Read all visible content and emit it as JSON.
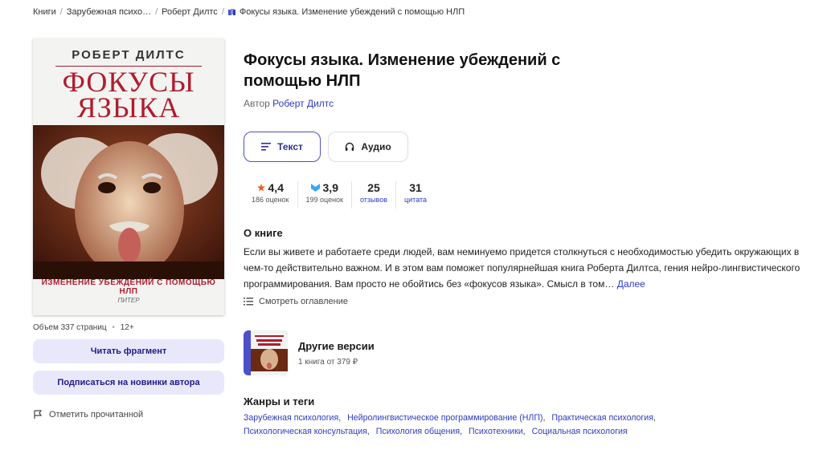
{
  "breadcrumb": {
    "items": [
      "Книги",
      "Зарубежная психо…",
      "Роберт Дилтс"
    ],
    "current": "Фокусы языка. Изменение убеждений с помощью НЛП"
  },
  "cover": {
    "author": "РОБЕРТ ДИЛТС",
    "title_line1": "ФОКУСЫ",
    "title_line2": "ЯЗЫКА",
    "subtitle": "ИЗМЕНЕНИЕ УБЕЖДЕНИЙ С ПОМОЩЬЮ НЛП",
    "publisher": "ПИТЕР"
  },
  "meta": {
    "pages": "Объем 337 страниц",
    "age": "12+"
  },
  "actions": {
    "read_fragment": "Читать фрагмент",
    "subscribe": "Подписаться на новинки автора",
    "mark_read": "Отметить прочитанной"
  },
  "book": {
    "title": "Фокусы языка. Изменение убеждений с помощью НЛП",
    "author_prefix": "Автор",
    "author": "Роберт Дилтс"
  },
  "formats": {
    "text": "Текст",
    "audio": "Аудио"
  },
  "stats": [
    {
      "value": "4,4",
      "label": "186 оценок",
      "icon": "star-icon"
    },
    {
      "value": "3,9",
      "label": "199 оценок",
      "icon": "bookmate-icon"
    },
    {
      "value": "25",
      "label": "отзывов"
    },
    {
      "value": "31",
      "label": "цитата"
    }
  ],
  "about": {
    "heading": "О книге",
    "text": "Если вы живете и работаете среди людей, вам неминуемо придется столкнуться с необходимостью убедить окружающих в чем-то действительно важном. И в этом вам поможет популярнейшая книга Роберта Дилтса, гения нейро-лингвистического программирования. Вам просто не обойтись без «фокусов языка». Смысл в том…",
    "more": "Далее",
    "toc": "Смотреть оглавление"
  },
  "versions": {
    "title": "Другие версии",
    "subtitle": "1 книга от 379 ₽"
  },
  "genres": {
    "heading": "Жанры и теги",
    "tags": [
      "Зарубежная психология",
      "Нейролингвистическое программирование (НЛП)",
      "Практическая психология",
      "Психологическая консультация",
      "Психология общения",
      "Психотехники",
      "Социальная психология"
    ]
  },
  "colors": {
    "accent": "#2d3cc2",
    "button_bg": "#e9e8fb",
    "cover_red": "#b01d2e",
    "star": "#f25a1c",
    "bookmate": "#3da5f4"
  }
}
